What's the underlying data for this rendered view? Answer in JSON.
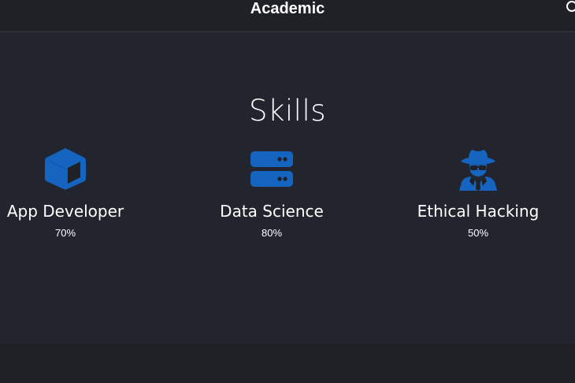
{
  "header": {
    "title": "Academic"
  },
  "skills": {
    "heading": "Skills",
    "items": [
      {
        "name": "App Developer",
        "percent": "70%",
        "icon": "cube-icon"
      },
      {
        "name": "Data Science",
        "percent": "80%",
        "icon": "server-icon"
      },
      {
        "name": "Ethical Hacking",
        "percent": "50%",
        "icon": "user-secret-icon"
      }
    ]
  },
  "colors": {
    "background": "#22252e",
    "header_background": "#1f2127",
    "accent": "#1565c0",
    "text": "#ffffff"
  }
}
